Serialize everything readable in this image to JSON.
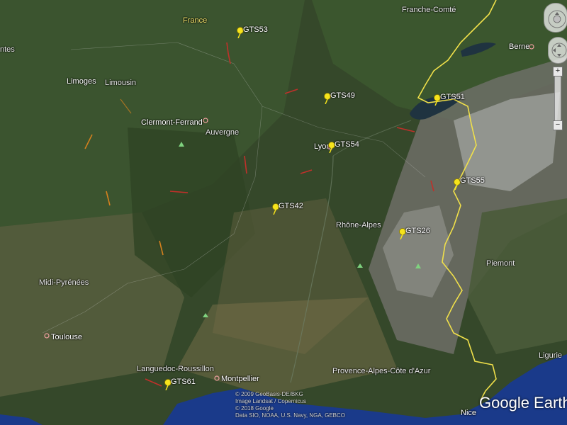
{
  "map": {
    "regions": [
      {
        "id": "france",
        "label": "France"
      },
      {
        "id": "franche-comte",
        "label": "Franche-Comté"
      },
      {
        "id": "berne",
        "label": "Berne"
      },
      {
        "id": "limoges",
        "label": "Limoges"
      },
      {
        "id": "limousin",
        "label": "Limousin"
      },
      {
        "id": "clermont-ferrand",
        "label": "Clermont-Ferrand"
      },
      {
        "id": "auvergne",
        "label": "Auvergne"
      },
      {
        "id": "lyon",
        "label": "Lyon"
      },
      {
        "id": "rhone-alpes",
        "label": "Rhône-Alpes"
      },
      {
        "id": "piemont",
        "label": "Piemont"
      },
      {
        "id": "midi-pyrenees",
        "label": "Midi-Pyrénées"
      },
      {
        "id": "toulouse",
        "label": "Toulouse"
      },
      {
        "id": "languedoc-roussillon",
        "label": "Languedoc-Roussillon"
      },
      {
        "id": "montpellier",
        "label": "Montpellier"
      },
      {
        "id": "provence",
        "label": "Provence-Alpes-Côte d'Azur"
      },
      {
        "id": "ligurie",
        "label": "Ligurie"
      },
      {
        "id": "nice",
        "label": "Nice"
      },
      {
        "id": "edge-left",
        "label": "ntes"
      }
    ],
    "placemarks": [
      {
        "id": "gts53",
        "label": "GTS53"
      },
      {
        "id": "gts49",
        "label": "GTS49"
      },
      {
        "id": "gts51",
        "label": "GTS51"
      },
      {
        "id": "gts54",
        "label": "GTS54"
      },
      {
        "id": "gts55",
        "label": "GTS55"
      },
      {
        "id": "gts42",
        "label": "GTS42"
      },
      {
        "id": "gts26",
        "label": "GTS26"
      },
      {
        "id": "gts61",
        "label": "GTS61"
      }
    ]
  },
  "attribution": [
    "© 2009 GeoBasis-DE/BKG",
    "Image Landsat / Copernicus",
    "© 2018 Google",
    "Data SIO, NOAA, U.S. Navy, NGA, GEBCO"
  ],
  "brand": "Google Earth",
  "controls": {
    "zoom_in": "+",
    "zoom_out": "−"
  },
  "colors": {
    "border_line": "#f0e04a",
    "pin": "#f6e41c",
    "track_red": "#c0302a",
    "track_orange": "#d4801e",
    "sea": "#1a3a8a"
  }
}
